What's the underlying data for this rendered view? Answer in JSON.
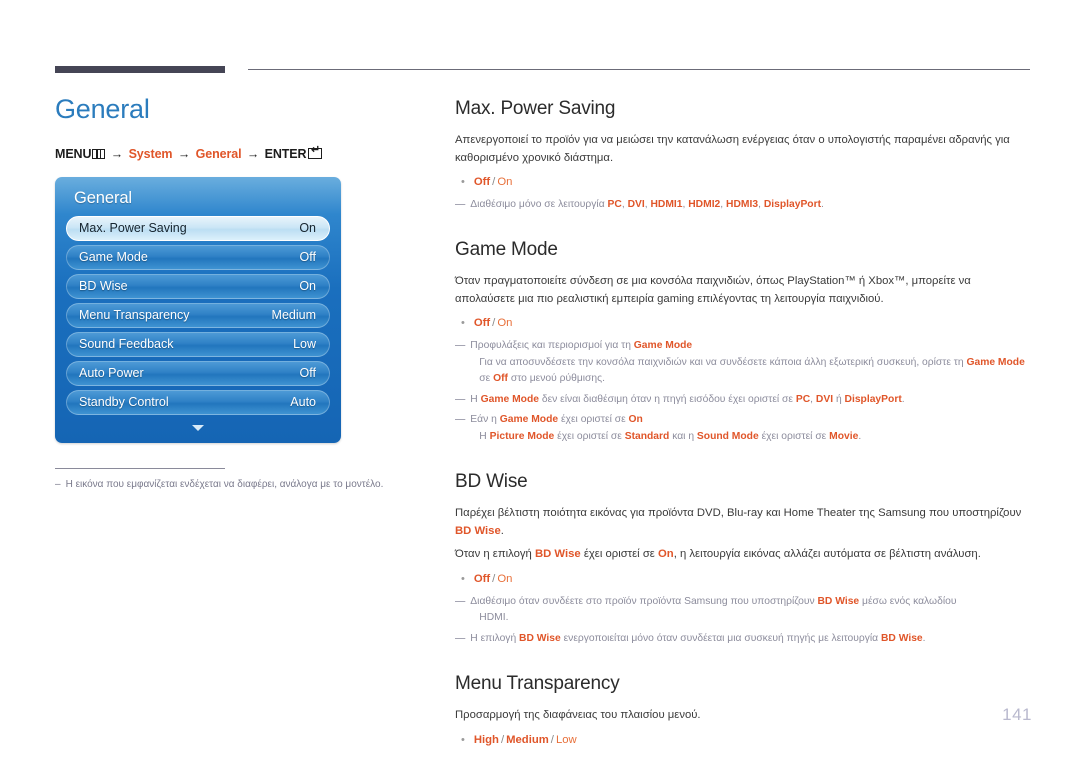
{
  "header": {
    "thick_rule": "",
    "thin_rule": ""
  },
  "left": {
    "title": "General",
    "breadcrumb": {
      "menu_label": "MENU",
      "menu_icon": "menu-keypad-icon",
      "arrow": "→",
      "step1": "System",
      "step2": "General",
      "enter_label": "ENTER",
      "enter_icon": "enter-key-icon"
    },
    "osd": {
      "title": "General",
      "rows": [
        {
          "label": "Max. Power Saving",
          "value": "On",
          "selected": true
        },
        {
          "label": "Game Mode",
          "value": "Off",
          "selected": false
        },
        {
          "label": "BD Wise",
          "value": "On",
          "selected": false
        },
        {
          "label": "Menu Transparency",
          "value": "Medium",
          "selected": false
        },
        {
          "label": "Sound Feedback",
          "value": "Low",
          "selected": false
        },
        {
          "label": "Auto Power",
          "value": "Off",
          "selected": false
        },
        {
          "label": "Standby Control",
          "value": "Auto",
          "selected": false
        }
      ],
      "scroll_icon": "chevron-down-icon"
    },
    "footnote": {
      "dash": "–",
      "text": "Η εικόνα που εμφανίζεται ενδέχεται να διαφέρει, ανάλογα με το μοντέλο."
    }
  },
  "sections": {
    "max_power_saving": {
      "heading": "Max. Power Saving",
      "paragraph": "Απενεργοποιεί το προϊόν για να μειώσει την κατανάλωση ενέργειας όταν ο υπολογιστής παραμένει αδρανής για καθορισμένο χρονικό διάστημα.",
      "options": {
        "bold": "Off",
        "sep": "/",
        "normal": "On"
      },
      "note": {
        "dash": "—",
        "pre": "Διαθέσιμο μόνο σε λειτουργία ",
        "t1": "PC",
        "c1": ", ",
        "t2": "DVI",
        "c2": ", ",
        "t3": "HDMI1",
        "c3": ", ",
        "t4": "HDMI2",
        "c4": ", ",
        "t5": "HDMI3",
        "c5": ", ",
        "t6": "DisplayPort",
        "post": "."
      }
    },
    "game_mode": {
      "heading": "Game Mode",
      "paragraph": "Όταν πραγματοποιείτε σύνδεση σε μια κονσόλα παιχνιδιών, όπως PlayStation™ ή Xbox™, μπορείτε να απολαύσετε μια πιο ρεαλιστική εμπειρία gaming επιλέγοντας τη λειτουργία παιχνιδιού.",
      "options": {
        "bold": "Off",
        "sep": "/",
        "normal": "On"
      },
      "note1": {
        "dash": "—",
        "pre": "Προφυλάξεις και περιορισμοί για τη ",
        "t1": "Game Mode",
        "sub_pre": "Για να αποσυνδέσετε την κονσόλα παιχνιδιών και να συνδέσετε κάποια άλλη εξωτερική συσκευή, ορίστε τη ",
        "sub_t1": "Game Mode",
        "sub_mid": " σε ",
        "sub_t2": "Off",
        "sub_post": " στο μενού ρύθμισης."
      },
      "note2": {
        "dash": "—",
        "pre": "Η ",
        "t1": "Game Mode",
        "mid": " δεν είναι διαθέσιμη όταν η πηγή εισόδου έχει οριστεί σε ",
        "t2": "PC",
        "c2": ", ",
        "t3": "DVI",
        "c3": " ή ",
        "t4": "DisplayPort",
        "post": "."
      },
      "note3": {
        "dash": "—",
        "pre": "Εάν η ",
        "t1": "Game Mode",
        "mid": " έχει οριστεί σε ",
        "t2": "On",
        "sub_pre": "Η ",
        "sub_t1": "Picture Mode",
        "sub_m1": " έχει οριστεί σε ",
        "sub_t2": "Standard",
        "sub_m2": " και η ",
        "sub_t3": "Sound Mode",
        "sub_m3": " έχει οριστεί σε ",
        "sub_t4": "Movie",
        "sub_post": "."
      }
    },
    "bd_wise": {
      "heading": "BD Wise",
      "p1_pre": "Παρέχει βέλτιστη ποιότητα εικόνας για προϊόντα DVD, Blu-ray και Home Theater της Samsung που υποστηρίζουν ",
      "p1_t1": "BD Wise",
      "p1_post": ".",
      "p2_pre": "Όταν η επιλογή ",
      "p2_t1": "BD Wise",
      "p2_mid": " έχει οριστεί σε ",
      "p2_t2": "On",
      "p2_post": ", η λειτουργία εικόνας αλλάζει αυτόματα σε βέλτιστη ανάλυση.",
      "options": {
        "bold": "Off",
        "sep": "/",
        "normal": "On"
      },
      "note1": {
        "dash": "—",
        "pre": "Διαθέσιμο όταν συνδέετε στο προϊόν προϊόντα Samsung που υποστηρίζουν ",
        "t1": "BD Wise",
        "post": " μέσω ενός καλωδίου",
        "sub": "HDMI."
      },
      "note2": {
        "dash": "—",
        "pre": "Η επιλογή ",
        "t1": "BD Wise",
        "mid": " ενεργοποιείται μόνο όταν συνδέεται μια συσκευή πηγής με λειτουργία ",
        "t2": "BD Wise",
        "post": "."
      }
    },
    "menu_transparency": {
      "heading": "Menu Transparency",
      "paragraph": "Προσαρμογή της διαφάνειας του πλαισίου μενού.",
      "options": {
        "o1": "High",
        "sep1": "/",
        "o2": "Medium",
        "sep2": "/",
        "o3": "Low"
      }
    }
  },
  "page_number": "141",
  "colors": {
    "accent_orange": "#e0562a",
    "title_blue": "#2b7cbd",
    "note_gray": "#8c8c9c",
    "osd_blue": "#1a6fbe"
  }
}
